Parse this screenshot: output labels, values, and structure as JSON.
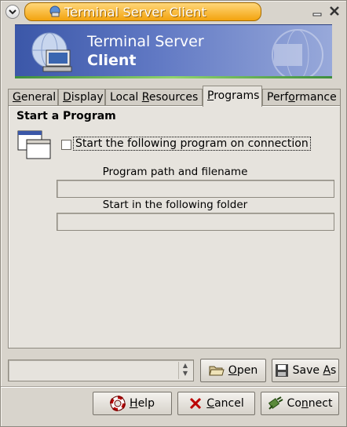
{
  "window": {
    "title": "Terminal Server Client"
  },
  "banner": {
    "line1": "Terminal Server",
    "line2": "Client"
  },
  "tabs": [
    {
      "pre": "",
      "key": "G",
      "post": "eneral"
    },
    {
      "pre": "",
      "key": "D",
      "post": "isplay"
    },
    {
      "pre": "Local ",
      "key": "R",
      "post": "esources"
    },
    {
      "pre": "",
      "key": "P",
      "post": "rograms"
    },
    {
      "pre": "Perf",
      "key": "o",
      "post": "rmance"
    }
  ],
  "programs": {
    "section_title": "Start a Program",
    "checkbox_label": "Start the following program on connection",
    "checked": false,
    "path_label": "Program path and filename",
    "path_value": "",
    "folder_label": "Start in the following folder",
    "folder_value": ""
  },
  "profile_combo": {
    "value": ""
  },
  "buttons": {
    "open": {
      "key": "O",
      "rest": "pen"
    },
    "save_as": {
      "pre": "Save ",
      "key": "A",
      "post": "s"
    },
    "help": {
      "key": "H",
      "rest": "elp"
    },
    "cancel": {
      "key": "C",
      "rest": "ancel"
    },
    "connect": {
      "pre": "Co",
      "key": "n",
      "post": "nect"
    }
  },
  "icons": {
    "window_menu": "chevron-down-icon",
    "app": "network-computer-icon",
    "minimize": "minimize-icon",
    "close": "close-icon"
  }
}
